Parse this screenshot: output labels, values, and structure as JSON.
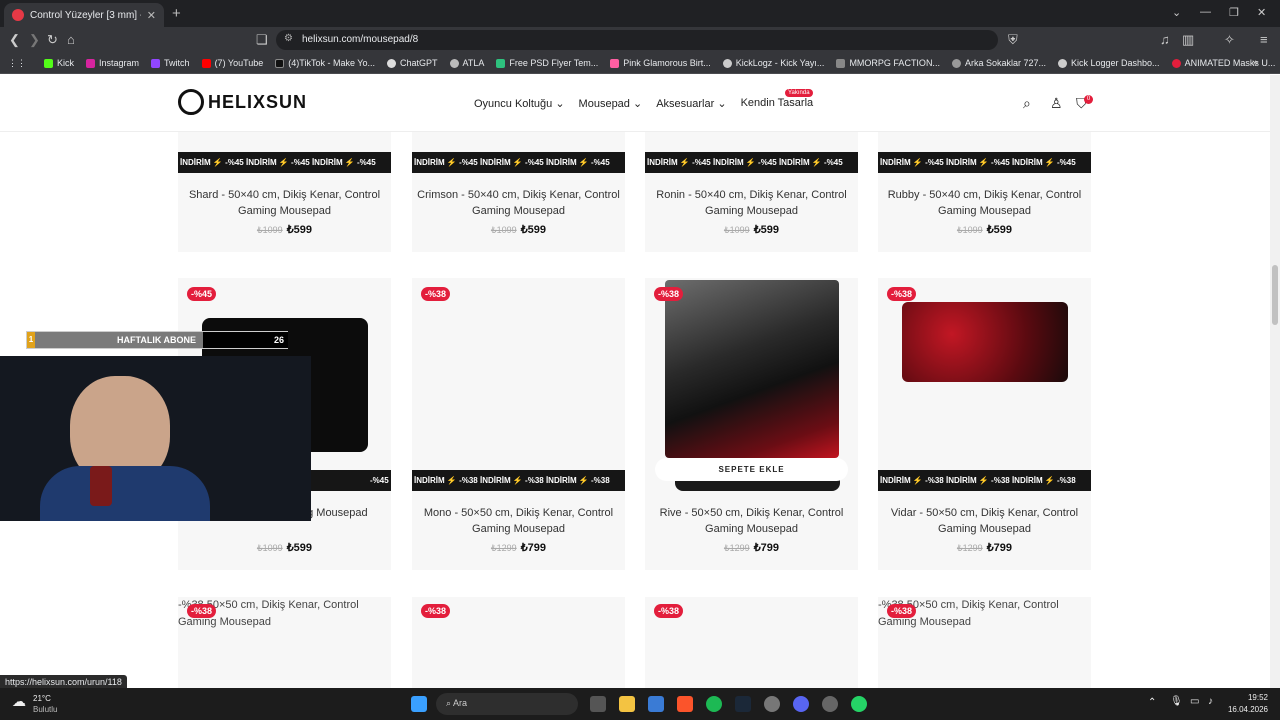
{
  "browser": {
    "tab_title": "Control Yüzeyler [3 mm] - Helix...",
    "url": "helixsun.com/mousepad/8",
    "bookmarks": [
      "Kick",
      "Instagram",
      "Twitch",
      "(7) YouTube",
      "(4)TikTok - Make Yo...",
      "ChatGPT",
      "ATLA",
      "Free PSD Flyer Tem...",
      "Pink Glamorous Birt...",
      "KickLogz - Kick Yayı...",
      "MMORPG FACTION...",
      "Arka Sokaklar 727...",
      "Kick Logger Dashbo...",
      "ANIMATED Masks U..."
    ],
    "status_url": "https://helixsun.com/urun/118"
  },
  "site": {
    "logo": "HELIXSUN",
    "nav": [
      "Oyuncu Koltuğu ⌄",
      "Mousepad ⌄",
      "Aksesuarlar ⌄",
      "Kendin Tasarla"
    ],
    "badge": "Yakında",
    "cart_count": "0"
  },
  "row1": [
    {
      "name": "Shard - 50×40 cm, Dikiş Kenar, Control Gaming Mousepad",
      "old": "₺1099",
      "new": "₺599",
      "band": "İNDİRİM ⚡ -%45 İNDİRİM ⚡ -%45 İNDİRİM ⚡ -%45"
    },
    {
      "name": "Crimson - 50×40 cm, Dikiş Kenar, Control Gaming Mousepad",
      "old": "₺1099",
      "new": "₺599",
      "band": "İNDİRİM ⚡ -%45 İNDİRİM ⚡ -%45 İNDİRİM ⚡ -%45"
    },
    {
      "name": "Ronin - 50×40 cm, Dikiş Kenar, Control Gaming Mousepad",
      "old": "₺1099",
      "new": "₺599",
      "band": "İNDİRİM ⚡ -%45 İNDİRİM ⚡ -%45 İNDİRİM ⚡ -%45"
    },
    {
      "name": "Rubby - 50×40 cm, Dikiş Kenar, Control Gaming Mousepad",
      "old": "₺1099",
      "new": "₺599",
      "band": "İNDİRİM ⚡ -%45 İNDİRİM ⚡ -%45 İNDİRİM ⚡ -%45"
    }
  ],
  "row2": [
    {
      "badge": "-%45",
      "name": "Kenar, Control Gaming Mousepad",
      "old": "₺1099",
      "new": "₺599",
      "band": "-%45"
    },
    {
      "badge": "-%38",
      "name": "Mono - 50×50 cm, Dikiş Kenar, Control Gaming Mousepad",
      "old": "₺1299",
      "new": "₺799",
      "band": "İNDİRİM ⚡ -%38 İNDİRİM ⚡ -%38 İNDİRİM ⚡ -%38"
    },
    {
      "badge": "-%38",
      "name": "Rive - 50×50 cm, Dikiş Kenar, Control Gaming Mousepad",
      "old": "₺1299",
      "new": "₺799",
      "cta": "SEPETE EKLE"
    },
    {
      "badge": "-%38",
      "name": "Vidar - 50×50 cm, Dikiş Kenar, Control Gaming Mousepad",
      "old": "₺1299",
      "new": "₺799",
      "band": "İNDİRİM ⚡ -%38 İNDİRİM ⚡ -%38 İNDİRİM ⚡ -%38"
    }
  ],
  "row3": [
    {
      "badge": "-%38",
      "alt": "-%38 50×50 cm, Dikiş Kenar, Control Gaming Mousepad"
    },
    {
      "badge": "-%38"
    },
    {
      "badge": "-%38"
    },
    {
      "badge": "-%38",
      "alt": "-%38 50×50 cm, Dikiş Kenar, Control Gaming Mousepad"
    }
  ],
  "overlay": {
    "rank": "1",
    "label": "HAFTALIK ABONE",
    "count": "26"
  },
  "taskbar": {
    "temp": "21°C",
    "weather": "Bulutlu",
    "search": "Ara",
    "time": "19:52",
    "date": "16.04.2026"
  },
  "colors": {
    "accent": "#e31e3c",
    "band": "#161616"
  }
}
